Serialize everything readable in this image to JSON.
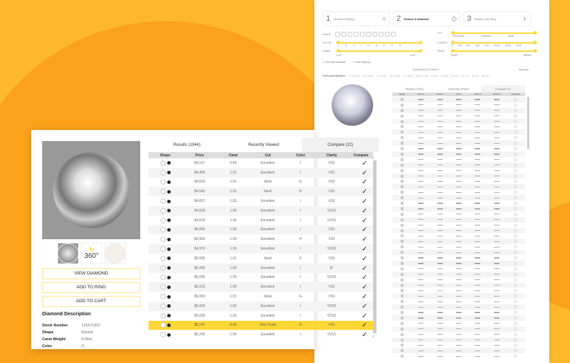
{
  "back_panel": {
    "steps": [
      {
        "num": "1",
        "label": "Choose A Setting",
        "icon": "ring-circle-icon"
      },
      {
        "num": "2",
        "label": "Choose A Diamond",
        "icon": "diamond-icon"
      },
      {
        "num": "3",
        "label": "Review Your Ring",
        "icon": "ring-icon"
      }
    ],
    "filters": {
      "shape": "SHAPE",
      "color": "COLOR",
      "carat": "CARAT",
      "cut": "CUT",
      "clarity": "CLARITY",
      "price": "PRICE",
      "color_ticks": [
        "L",
        "K",
        "J",
        "I",
        "H",
        "G",
        "F",
        "E",
        "D"
      ],
      "cut_ticks": [
        "Very Good",
        "Excellent",
        "Ideal"
      ],
      "clarity_ticks": [
        "I1",
        "SI2",
        "SI1",
        "VS2",
        "VS1",
        "VVS2",
        "VVS1",
        "FL/IF"
      ],
      "carat_min": "0.10",
      "carat_max": "5.41",
      "price_min": "$1067",
      "price_max": "$85100"
    },
    "checkboxes": [
      "360 View Available",
      "Fast Shipping"
    ],
    "advanced": "ADVANCED FILTERS ▾",
    "reset": "Reset All",
    "popular_label": "POPULAR SEARCH",
    "popular": [
      "0.75 Carat",
      "One Carat",
      "1.5 Carat",
      "Two Carat",
      "2.5 Carat",
      "Three Carat",
      "$2,000",
      "$3,000",
      "$5,000",
      "$4,000",
      "$6,000",
      "$8,000"
    ],
    "tabs": [
      "Results (1944)",
      "Recently Viewed",
      "Compare (1)"
    ],
    "columns": [
      "Shape",
      "Price ▾",
      "Carat ▾",
      "Cut ▾",
      "Color ▾",
      "Clarity ▾",
      "Compare"
    ]
  },
  "front_panel": {
    "buttons": {
      "view": "VIEW DIAMOND",
      "ring": "ADD TO RING",
      "cart": "ADD TO CART"
    },
    "thumb_360": "360°",
    "description_title": "Diamond Description",
    "description": [
      {
        "label": "Stock Number",
        "value": "121671337"
      },
      {
        "label": "Shape",
        "value": "Round"
      },
      {
        "label": "Carat Weight",
        "value": "0.90ct."
      },
      {
        "label": "Color",
        "value": "D"
      }
    ],
    "tabs": [
      "Results (1944)",
      "Recently Viewed",
      "Compare (22)"
    ],
    "columns": [
      "Shape",
      "Price",
      "Carat",
      "Cut",
      "Color",
      "Clarity",
      "Compare"
    ],
    "rows": [
      {
        "price": "$4,107",
        "carat": "0.90",
        "cut": "Excellent",
        "color": "I",
        "clarity": "VS1"
      },
      {
        "price": "$4,499",
        "carat": "1.01",
        "cut": "Excellent",
        "color": "I",
        "clarity": "VS1"
      },
      {
        "price": "$4,503",
        "carat": "1.01",
        "cut": "Ideal",
        "color": "G",
        "clarity": "VS2"
      },
      {
        "price": "$4,542",
        "carat": "1.01",
        "cut": "Ideal",
        "color": "G",
        "clarity": "VS1"
      },
      {
        "price": "$4,837",
        "carat": "1.02",
        "cut": "Excellent",
        "color": "I",
        "clarity": "VS2"
      },
      {
        "price": "$4,818",
        "carat": "1.00",
        "cut": "Excellent",
        "color": "I",
        "clarity": "VVS1"
      },
      {
        "price": "$4,818",
        "carat": "1.00",
        "cut": "Excellent",
        "color": "I",
        "clarity": "VVS1"
      },
      {
        "price": "$4,845",
        "carat": "1.00",
        "cut": "Excellent",
        "color": "I",
        "clarity": "VS1"
      },
      {
        "price": "$4,950",
        "carat": "1.00",
        "cut": "Excellent",
        "color": "H",
        "clarity": "VS2"
      },
      {
        "price": "$4,970",
        "carat": "1.00",
        "cut": "Excellent",
        "color": "I",
        "clarity": "VVS2"
      },
      {
        "price": "$5,005",
        "carat": "1.01",
        "cut": "Ideal",
        "color": "F",
        "clarity": "VS1"
      },
      {
        "price": "$5,005",
        "carat": "1.00",
        "cut": "Excellent",
        "color": "I",
        "clarity": "IF"
      },
      {
        "price": "$5,006",
        "carat": "1.00",
        "cut": "Excellent",
        "color": "I",
        "clarity": "VVS2"
      },
      {
        "price": "$5,015",
        "carat": "1.00",
        "cut": "Excellent",
        "color": "I",
        "clarity": "VS1"
      },
      {
        "price": "$5,050",
        "carat": "1.01",
        "cut": "Ideal",
        "color": "G",
        "clarity": "VS1"
      },
      {
        "price": "$5,059",
        "carat": "1.00",
        "cut": "Excellent",
        "color": "I",
        "clarity": "VVS2"
      },
      {
        "price": "$5,059",
        "carat": "1.00",
        "cut": "Excellent",
        "color": "I",
        "clarity": "VVS2"
      },
      {
        "price": "$5,147",
        "carat": "0.90",
        "cut": "Very Good",
        "color": "D",
        "clarity": "VS1",
        "highlighted": true
      },
      {
        "price": "$5,245",
        "carat": "1.05",
        "cut": "Excellent",
        "color": "I",
        "clarity": "VVS1"
      }
    ]
  },
  "colors": {
    "background": "#FDB92A",
    "accent": "#FDD835",
    "circle": "#FBA21A"
  }
}
